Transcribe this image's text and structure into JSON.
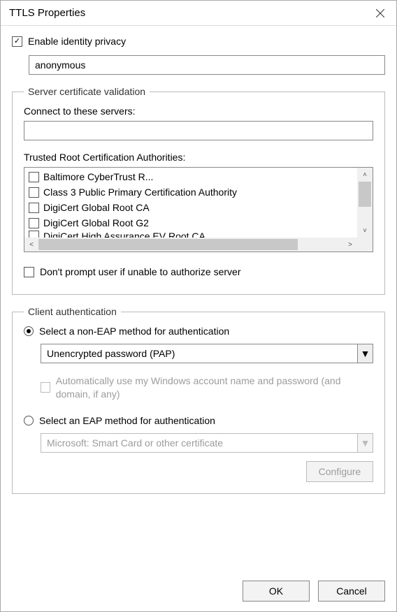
{
  "window": {
    "title": "TTLS Properties"
  },
  "identity": {
    "enable_label": "Enable identity privacy",
    "enable_checked": true,
    "value": "anonymous"
  },
  "server_validation": {
    "group_title": "Server certificate validation",
    "connect_label": "Connect to these servers:",
    "connect_value": "",
    "trusted_label": "Trusted Root Certification Authorities:",
    "authorities": [
      {
        "label": "Baltimore CyberTrust R...",
        "checked": false
      },
      {
        "label": "Class 3 Public Primary Certification Authority",
        "checked": false
      },
      {
        "label": "DigiCert Global Root CA",
        "checked": false
      },
      {
        "label": "DigiCert Global Root G2",
        "checked": false
      },
      {
        "label": "DigiCert High Assurance EV Root CA",
        "checked": false
      }
    ],
    "dont_prompt_label": "Don't prompt user if unable to authorize server",
    "dont_prompt_checked": false
  },
  "client_auth": {
    "group_title": "Client authentication",
    "non_eap_radio_label": "Select a non-EAP method for authentication",
    "non_eap_selected": true,
    "non_eap_method": "Unencrypted password (PAP)",
    "auto_creds_label": "Automatically use my Windows account name and password (and domain, if any)",
    "auto_creds_checked": false,
    "auto_creds_enabled": false,
    "eap_radio_label": "Select an EAP method for authentication",
    "eap_selected": false,
    "eap_method": "Microsoft: Smart Card or other certificate",
    "eap_enabled": false,
    "configure_label": "Configure",
    "configure_enabled": false
  },
  "buttons": {
    "ok": "OK",
    "cancel": "Cancel"
  }
}
